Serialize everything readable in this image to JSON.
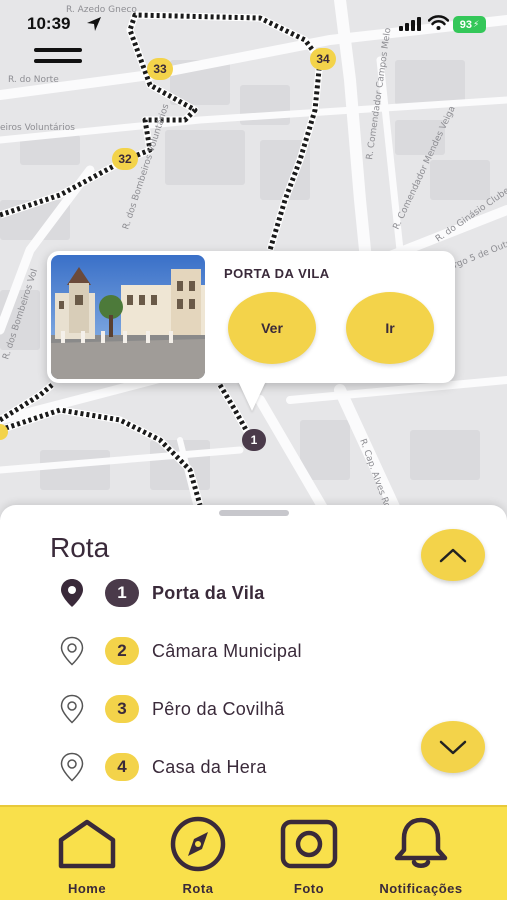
{
  "status_bar": {
    "time": "10:39",
    "battery": "93"
  },
  "map": {
    "streets": [
      "R. Azedo Gneco",
      "R. do Norte",
      "eiros Voluntários",
      "R. dos Bombeiros Voluntários",
      "R. dos Bombeiros Vol",
      "R. Comendador Campos Melo",
      "R. Comendador Mendes Veiga",
      "R. do Ginásio Clube",
      "Largo 5 de Outu",
      "R. Cap. Alves Roçad"
    ],
    "markers": [
      "33",
      "34",
      "32",
      "1"
    ]
  },
  "popup": {
    "title": "PORTA DA VILA",
    "ver_label": "Ver",
    "ir_label": "Ir"
  },
  "sheet": {
    "title": "Rota",
    "stops": [
      {
        "number": "1",
        "name": "Porta da Vila",
        "active": true
      },
      {
        "number": "2",
        "name": "Câmara Municipal",
        "active": false
      },
      {
        "number": "3",
        "name": "Pêro da Covilhã",
        "active": false
      },
      {
        "number": "4",
        "name": "Casa da Hera",
        "active": false
      }
    ]
  },
  "tabbar": {
    "tabs": [
      {
        "label": "Home",
        "icon": "home-icon"
      },
      {
        "label": "Rota",
        "icon": "compass-icon"
      },
      {
        "label": "Foto",
        "icon": "camera-icon"
      },
      {
        "label": "Notificações",
        "icon": "bell-icon"
      }
    ]
  },
  "colors": {
    "accent": "#f3d34a",
    "dark": "#4a3a4a",
    "tabbar": "#f9e04b",
    "map": "#e6e6e8"
  }
}
